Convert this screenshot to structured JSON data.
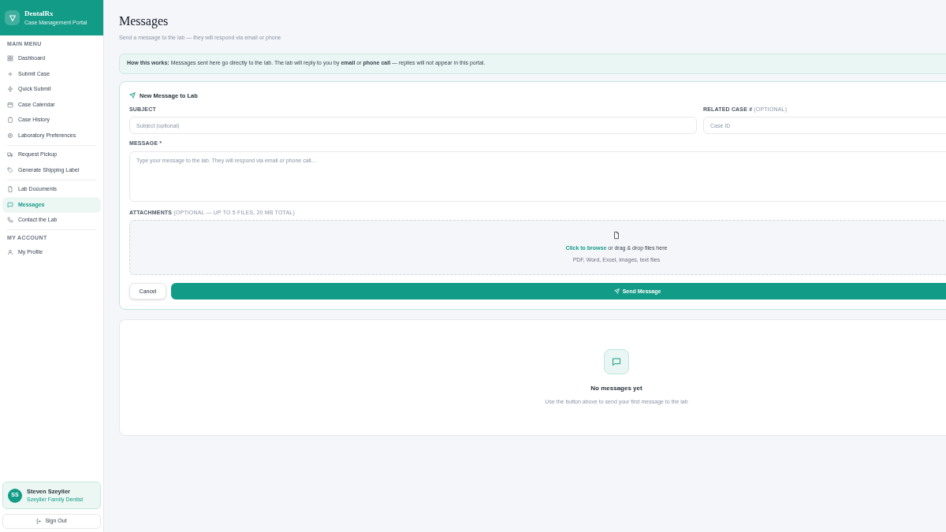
{
  "brand": {
    "name": "DentalRx",
    "tagline": "Case Management Portal"
  },
  "sidebar": {
    "sections": [
      {
        "heading": "MAIN MENU",
        "groups": [
          [
            {
              "label": "Dashboard",
              "selected": false
            },
            {
              "label": "Submit Case",
              "selected": false
            },
            {
              "label": "Quick Submit",
              "selected": false
            },
            {
              "label": "Case Calendar",
              "selected": false
            },
            {
              "label": "Case History",
              "selected": false
            },
            {
              "label": "Laboratory Preferences",
              "selected": false
            }
          ],
          [
            {
              "label": "Request Pickup",
              "selected": false
            },
            {
              "label": "Generate Shipping Label",
              "selected": false
            }
          ],
          [
            {
              "label": "Lab Documents",
              "selected": false
            },
            {
              "label": "Messages",
              "selected": true
            },
            {
              "label": "Contact the Lab",
              "selected": false
            }
          ]
        ]
      },
      {
        "heading": "MY ACCOUNT",
        "groups": [
          [
            {
              "label": "My Profile",
              "selected": false
            }
          ]
        ]
      }
    ]
  },
  "user": {
    "initials": "SS",
    "name": "Steven Szeyller",
    "practice": "Szeyller Family Dentist"
  },
  "sign_out": "Sign Out",
  "page": {
    "title": "Messages",
    "subtitle": "Send a message to the lab — they will respond via email or phone"
  },
  "notice": "**How this works:** Messages sent here go directly to the lab. The lab will reply to you by **email** or **phone call** — replies will not appear in this portal.",
  "form": {
    "title": "New Message to Lab",
    "subject": {
      "label": "SUBJECT",
      "placeholder": "Subject (optional)"
    },
    "case": {
      "label": "RELATED CASE #",
      "hint": "(OPTIONAL)",
      "placeholder": "Case ID"
    },
    "message": {
      "label": "MESSAGE *",
      "placeholder": "Type your message to the lab. They will respond via email or phone call..."
    },
    "attachments": {
      "label": "ATTACHMENTS",
      "hint": "(OPTIONAL — UP TO 5 FILES, 20 MB TOTAL)",
      "link": "Click to browse",
      "rest": "or drag & drop files here",
      "types": "PDF, Word, Excel, images, text files"
    },
    "cancel": "Cancel",
    "send": "Send Message"
  },
  "empty": {
    "title": "No messages yet",
    "text": "Use the button above to send your first message to the lab"
  }
}
